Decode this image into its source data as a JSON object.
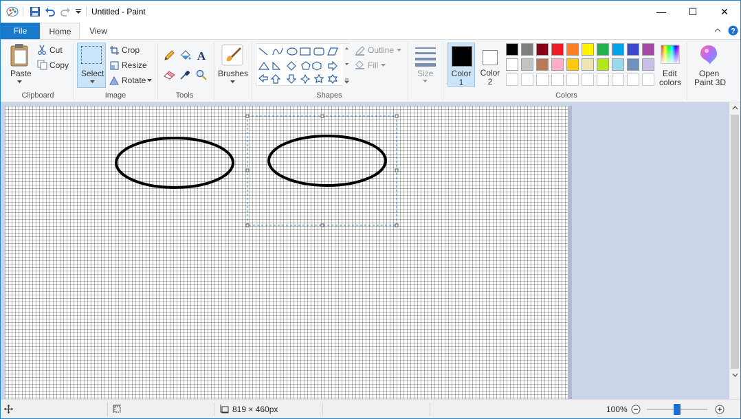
{
  "titlebar": {
    "title": "Untitled - Paint",
    "minimize_glyph": "—",
    "maximize_glyph": "☐",
    "close_glyph": "✕"
  },
  "tabs": {
    "file": "File",
    "home": "Home",
    "view": "View"
  },
  "clipboard": {
    "paste": "Paste",
    "cut": "Cut",
    "copy": "Copy",
    "group": "Clipboard"
  },
  "image": {
    "select": "Select",
    "crop": "Crop",
    "resize": "Resize",
    "rotate": "Rotate",
    "group": "Image"
  },
  "tools": {
    "group": "Tools"
  },
  "brushes": {
    "label": "Brushes"
  },
  "shapes": {
    "outline": "Outline",
    "fill": "Fill",
    "group": "Shapes"
  },
  "size": {
    "label": "Size"
  },
  "colors": {
    "color1_line1": "Color",
    "color1_line2": "1",
    "color2_line1": "Color",
    "color2_line2": "2",
    "color1": "#000000",
    "color2": "#ffffff",
    "palette_row1": [
      "#000000",
      "#7f7f7f",
      "#880015",
      "#ed1c24",
      "#ff7f27",
      "#fff200",
      "#22b14c",
      "#00a2e8",
      "#3f48cc",
      "#a349a4"
    ],
    "palette_row2": [
      "#ffffff",
      "#c3c3c3",
      "#b97a57",
      "#ffaec9",
      "#ffc90e",
      "#efe4b0",
      "#b5e61d",
      "#99d9ea",
      "#7092be",
      "#c8bfe7"
    ],
    "edit_line1": "Edit",
    "edit_line2": "colors",
    "group": "Colors"
  },
  "paint3d": {
    "line1": "Open",
    "line2": "Paint 3D"
  },
  "statusbar": {
    "dimensions": "819 × 460px",
    "zoom": "100%"
  }
}
